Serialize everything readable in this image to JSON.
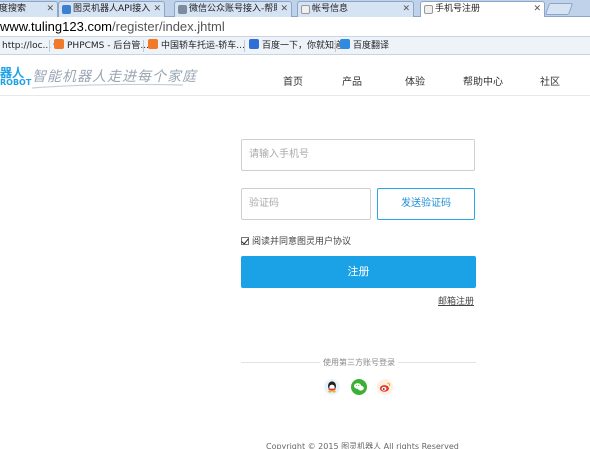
{
  "browser": {
    "tabs": [
      {
        "title": "度搜索"
      },
      {
        "title": "图灵机器人API接入_互联"
      },
      {
        "title": "微信公众账号接入-帮助中"
      },
      {
        "title": "帐号信息"
      },
      {
        "title": "手机号注册",
        "active": true
      }
    ],
    "url_host": "www.tuling123.com",
    "url_path": "/register/index.jhtml",
    "bookmarks": [
      {
        "label": "http://loc...",
        "icon": "page-icon"
      },
      {
        "label": "PHPCMS - 后台管...",
        "icon": "phpcms-icon"
      },
      {
        "label": "中国轿车托运-轿车...",
        "icon": "phpcms-icon"
      },
      {
        "label": "百度一下，你就知道",
        "icon": "baidu-icon"
      },
      {
        "label": "百度翻译",
        "icon": "translate-icon"
      }
    ]
  },
  "header": {
    "logo_text": "器人",
    "logo_sub": "ROBOT",
    "slogan": "智能机器人走进每个家庭",
    "nav": [
      "首页",
      "产品",
      "体验",
      "帮助中心",
      "社区"
    ]
  },
  "form": {
    "phone_placeholder": "请输入手机号",
    "code_placeholder": "验证码",
    "send_code_label": "发送验证码",
    "agree_label": "阅读并同意图灵用户协议",
    "agree_checked": true,
    "submit_label": "注册",
    "email_register_label": "邮箱注册"
  },
  "third_party": {
    "title": "使用第三方账号登录",
    "providers": [
      "qq-icon",
      "wechat-icon",
      "weibo-icon"
    ]
  },
  "footer": {
    "copyright": "Copyright © 2015 图灵机器人 All rights Reserved"
  },
  "colors": {
    "primary": "#1ba1e6",
    "tab_strip": "#bfd2ea",
    "qq": "#2d9de0",
    "wechat": "#3cb034",
    "weibo": "#e8a020"
  }
}
